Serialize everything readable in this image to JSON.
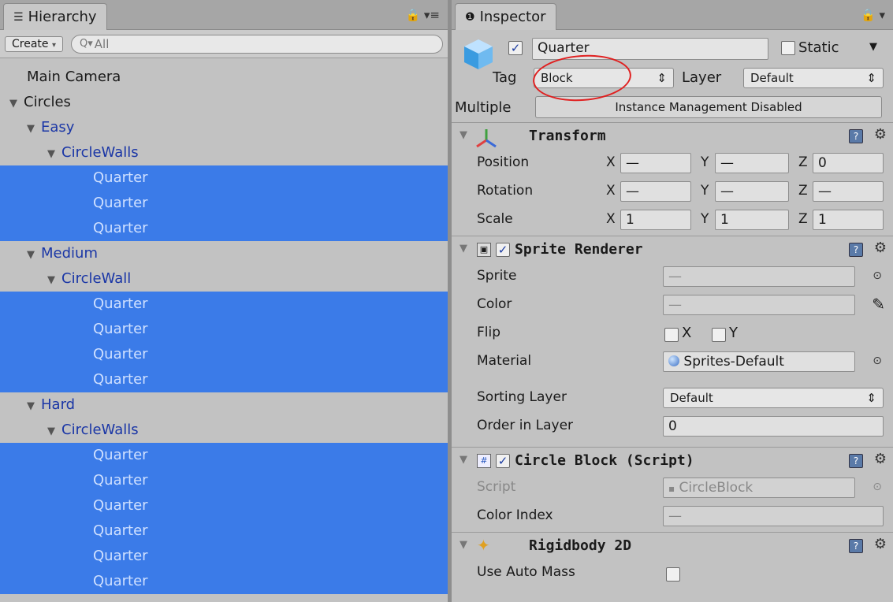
{
  "hierarchy": {
    "tab_label": "Hierarchy",
    "create_label": "Create",
    "search_placeholder": "All",
    "items": [
      {
        "label": "Main Camera",
        "indent": 0,
        "arrow": false,
        "selected": false,
        "blue": false
      },
      {
        "label": "Circles",
        "indent": 0,
        "arrow": true,
        "selected": false,
        "blue": false
      },
      {
        "label": "Easy",
        "indent": 1,
        "arrow": true,
        "selected": false,
        "blue": true
      },
      {
        "label": "CircleWalls",
        "indent": 2,
        "arrow": true,
        "selected": false,
        "blue": true
      },
      {
        "label": "Quarter",
        "indent": 3,
        "arrow": false,
        "selected": true,
        "blue": false
      },
      {
        "label": "Quarter",
        "indent": 3,
        "arrow": false,
        "selected": true,
        "blue": false
      },
      {
        "label": "Quarter",
        "indent": 3,
        "arrow": false,
        "selected": true,
        "blue": false
      },
      {
        "label": "Medium",
        "indent": 1,
        "arrow": true,
        "selected": false,
        "blue": true
      },
      {
        "label": "CircleWall",
        "indent": 2,
        "arrow": true,
        "selected": false,
        "blue": true
      },
      {
        "label": "Quarter",
        "indent": 3,
        "arrow": false,
        "selected": true,
        "blue": false
      },
      {
        "label": "Quarter",
        "indent": 3,
        "arrow": false,
        "selected": true,
        "blue": false
      },
      {
        "label": "Quarter",
        "indent": 3,
        "arrow": false,
        "selected": true,
        "blue": false
      },
      {
        "label": "Quarter",
        "indent": 3,
        "arrow": false,
        "selected": true,
        "blue": false
      },
      {
        "label": "Hard",
        "indent": 1,
        "arrow": true,
        "selected": false,
        "blue": true
      },
      {
        "label": "CircleWalls",
        "indent": 2,
        "arrow": true,
        "selected": false,
        "blue": true
      },
      {
        "label": "Quarter",
        "indent": 3,
        "arrow": false,
        "selected": true,
        "blue": false
      },
      {
        "label": "Quarter",
        "indent": 3,
        "arrow": false,
        "selected": true,
        "blue": false
      },
      {
        "label": "Quarter",
        "indent": 3,
        "arrow": false,
        "selected": true,
        "blue": false
      },
      {
        "label": "Quarter",
        "indent": 3,
        "arrow": false,
        "selected": true,
        "blue": false
      },
      {
        "label": "Quarter",
        "indent": 3,
        "arrow": false,
        "selected": true,
        "blue": false
      },
      {
        "label": "Quarter",
        "indent": 3,
        "arrow": false,
        "selected": true,
        "blue": false
      }
    ]
  },
  "inspector": {
    "tab_label": "Inspector",
    "object_name": "Quarter",
    "static_label": "Static",
    "tag_label": "Tag",
    "tag_value": "Block",
    "layer_label": "Layer",
    "layer_value": "Default",
    "multiple_label": "Multiple",
    "instance_label": "Instance Management Disabled",
    "transform": {
      "title": "Transform",
      "position_label": "Position",
      "rotation_label": "Rotation",
      "scale_label": "Scale",
      "x": "X",
      "y": "Y",
      "z": "Z",
      "position": [
        "—",
        "—",
        "0"
      ],
      "rotation": [
        "—",
        "—",
        "—"
      ],
      "scale": [
        "1",
        "1",
        "1"
      ]
    },
    "sprite_renderer": {
      "title": "Sprite Renderer",
      "sprite_label": "Sprite",
      "sprite_value": "—",
      "color_label": "Color",
      "color_value": "—",
      "flip_label": "Flip",
      "flip_x": "X",
      "flip_y": "Y",
      "material_label": "Material",
      "material_value": "Sprites-Default",
      "sorting_label": "Sorting Layer",
      "sorting_value": "Default",
      "order_label": "Order in Layer",
      "order_value": "0"
    },
    "circle_block": {
      "title": "Circle Block (Script)",
      "script_label": "Script",
      "script_value": "CircleBlock",
      "color_index_label": "Color Index",
      "color_index_value": "—"
    },
    "rigidbody": {
      "title": "Rigidbody 2D",
      "auto_mass_label": "Use Auto Mass"
    }
  },
  "colors": {
    "selection": "#3b7be8",
    "annotation": "#e02020",
    "tree_blue": "#1a36a6"
  }
}
